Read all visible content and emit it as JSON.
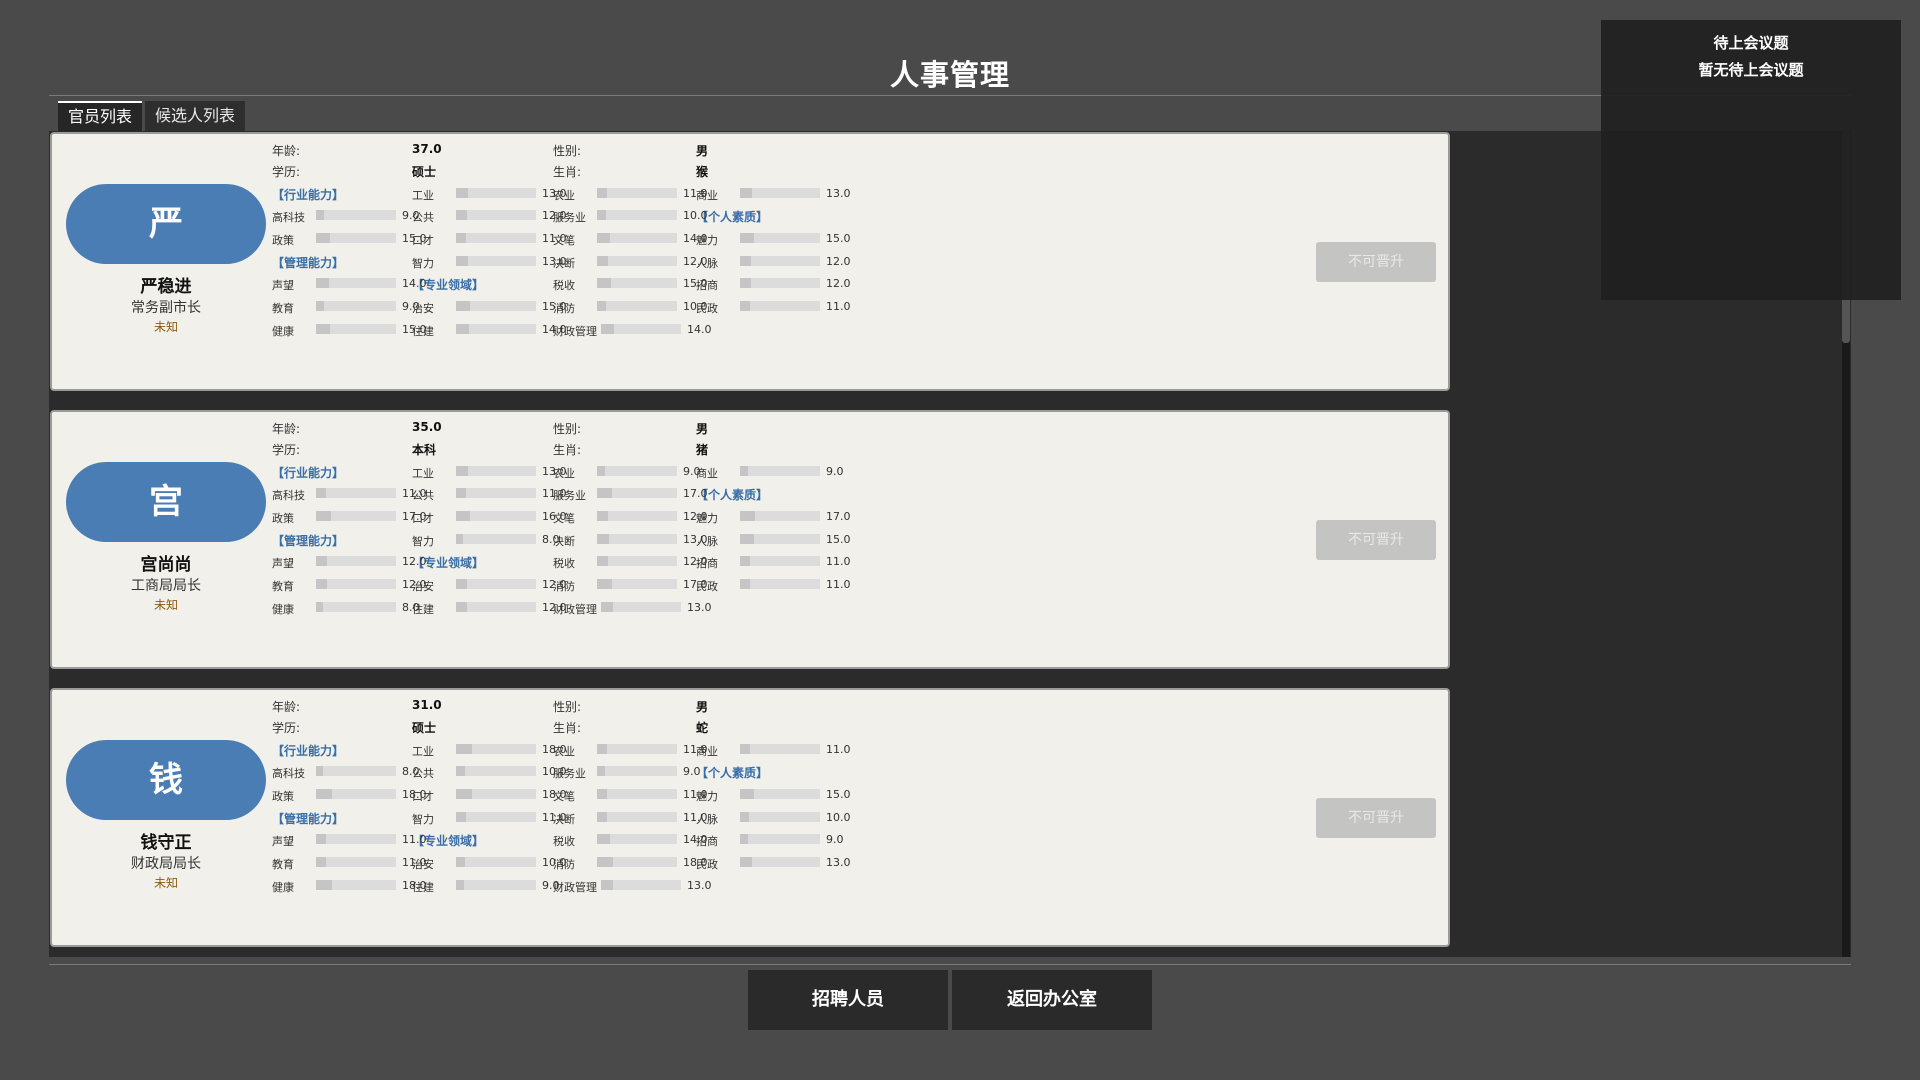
{
  "page_title": "人事管理",
  "tabs": [
    "官员列表",
    "候选人列表"
  ],
  "agenda": {
    "title": "待上会议题",
    "empty_text": "暂无待上会议题"
  },
  "buttons": {
    "recruit": "招聘人员",
    "back_office": "返回办公室"
  },
  "field_labels": {
    "age": "年龄:",
    "gender": "性别:",
    "education": "学历:",
    "zodiac": "生肖:",
    "industry": "【行业能力】",
    "management": "【管理能力】",
    "domain": "【专业领域】",
    "personal": "【个人素质】"
  },
  "stat_labels": {
    "gongye": "工业",
    "nongye": "农业",
    "shangye": "商业",
    "gaokeji": "高科技",
    "gonggong": "公共",
    "fuwuye": "服务业",
    "zhengce": "政策",
    "koucai": "口才",
    "wenbi": "文笔",
    "meili": "魅力",
    "zhili": "智力",
    "jueduan": "决断",
    "renmai": "人脉",
    "shengwang": "声望",
    "shuishou": "税收",
    "zhaoshang": "招商",
    "jiaoyu": "教育",
    "zhian": "治安",
    "xiaofang": "消防",
    "minzheng": "民政",
    "jiankang": "健康",
    "zhujian": "住建",
    "caizheng": "财政管理"
  },
  "officials": [
    {
      "avatar_char": "严",
      "name": "严稳进",
      "position": "常务副市长",
      "status": "未知",
      "age": "37.0",
      "gender": "男",
      "education": "硕士",
      "zodiac": "猴",
      "promote_label": "不可晋升",
      "stats": {
        "gongye": "13.0",
        "nongye": "11.0",
        "shangye": "13.0",
        "gaokeji": "9.0",
        "gonggong": "12.0",
        "fuwuye": "10.0",
        "zhengce": "15.0",
        "koucai": "11.0",
        "wenbi": "14.0",
        "meili": "15.0",
        "zhili": "13.0",
        "jueduan": "12.0",
        "renmai": "12.0",
        "shengwang": "14.0",
        "shuishou": "15.0",
        "zhaoshang": "12.0",
        "jiaoyu": "9.0",
        "zhian": "15.0",
        "xiaofang": "10.0",
        "minzheng": "11.0",
        "jiankang": "15.0",
        "zhujian": "14.0",
        "caizheng": "14.0"
      }
    },
    {
      "avatar_char": "宫",
      "name": "宫尚尚",
      "position": "工商局局长",
      "status": "未知",
      "age": "35.0",
      "gender": "男",
      "education": "本科",
      "zodiac": "猪",
      "promote_label": "不可晋升",
      "stats": {
        "gongye": "13.0",
        "nongye": "9.0",
        "shangye": "9.0",
        "gaokeji": "11.0",
        "gonggong": "11.0",
        "fuwuye": "17.0",
        "zhengce": "17.0",
        "koucai": "16.0",
        "wenbi": "12.0",
        "meili": "17.0",
        "zhili": "8.0",
        "jueduan": "13.0",
        "renmai": "15.0",
        "shengwang": "12.0",
        "shuishou": "12.0",
        "zhaoshang": "11.0",
        "jiaoyu": "12.0",
        "zhian": "12.0",
        "xiaofang": "17.0",
        "minzheng": "11.0",
        "jiankang": "8.0",
        "zhujian": "12.0",
        "caizheng": "13.0"
      }
    },
    {
      "avatar_char": "钱",
      "name": "钱守正",
      "position": "财政局局长",
      "status": "未知",
      "age": "31.0",
      "gender": "男",
      "education": "硕士",
      "zodiac": "蛇",
      "promote_label": "不可晋升",
      "stats": {
        "gongye": "18.0",
        "nongye": "11.0",
        "shangye": "11.0",
        "gaokeji": "8.0",
        "gonggong": "10.0",
        "fuwuye": "9.0",
        "zhengce": "18.0",
        "koucai": "18.0",
        "wenbi": "11.0",
        "meili": "15.0",
        "zhili": "11.0",
        "jueduan": "11.0",
        "renmai": "10.0",
        "shengwang": "11.0",
        "shuishou": "14.0",
        "zhaoshang": "9.0",
        "jiaoyu": "11.0",
        "zhian": "10.0",
        "xiaofang": "18.0",
        "minzheng": "13.0",
        "jiankang": "18.0",
        "zhujian": "9.0",
        "caizheng": "13.0"
      }
    }
  ]
}
